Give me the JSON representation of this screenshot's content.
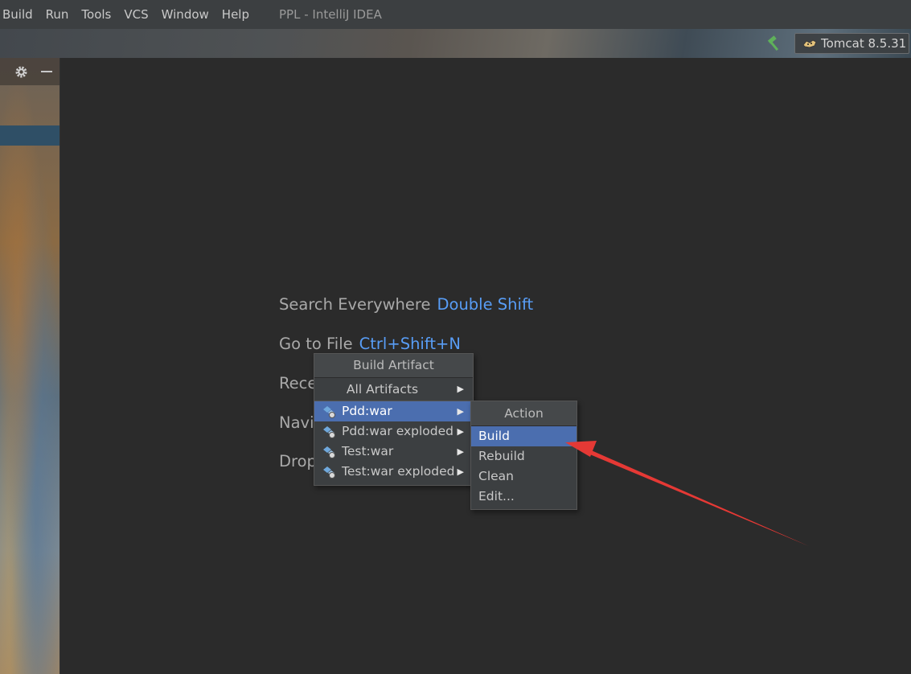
{
  "menubar": {
    "items": [
      {
        "label": "Build"
      },
      {
        "label": "Run"
      },
      {
        "label": "Tools"
      },
      {
        "label": "VCS"
      },
      {
        "label": "Window"
      },
      {
        "label": "Help"
      }
    ],
    "window_title": "PPL - IntelliJ IDEA"
  },
  "toolbar": {
    "build_icon": "hammer-icon",
    "run_config": {
      "label": "Tomcat 8.5.31",
      "icon": "tomcat-icon"
    }
  },
  "side_panel": {
    "icons": [
      "gear-icon",
      "minus-icon"
    ]
  },
  "editor_hints": [
    {
      "label": "Search Everywhere",
      "shortcut": "Double Shift"
    },
    {
      "label": "Go to File",
      "shortcut": "Ctrl+Shift+N"
    },
    {
      "label": "Rece"
    },
    {
      "label": "Navi"
    },
    {
      "label": "Drop"
    }
  ],
  "build_artifact_popup": {
    "title": "Build Artifact",
    "all_label": "All Artifacts",
    "items": [
      {
        "label": "Pdd:war",
        "selected": true
      },
      {
        "label": "Pdd:war exploded"
      },
      {
        "label": "Test:war"
      },
      {
        "label": "Test:war exploded"
      }
    ]
  },
  "action_popup": {
    "title": "Action",
    "items": [
      {
        "label": "Build",
        "selected": true
      },
      {
        "label": "Rebuild"
      },
      {
        "label": "Clean"
      },
      {
        "label": "Edit..."
      }
    ]
  },
  "colors": {
    "accent_selection": "#4b6eaf",
    "shortcut_blue": "#589df6",
    "annotation_arrow": "#e53935"
  }
}
